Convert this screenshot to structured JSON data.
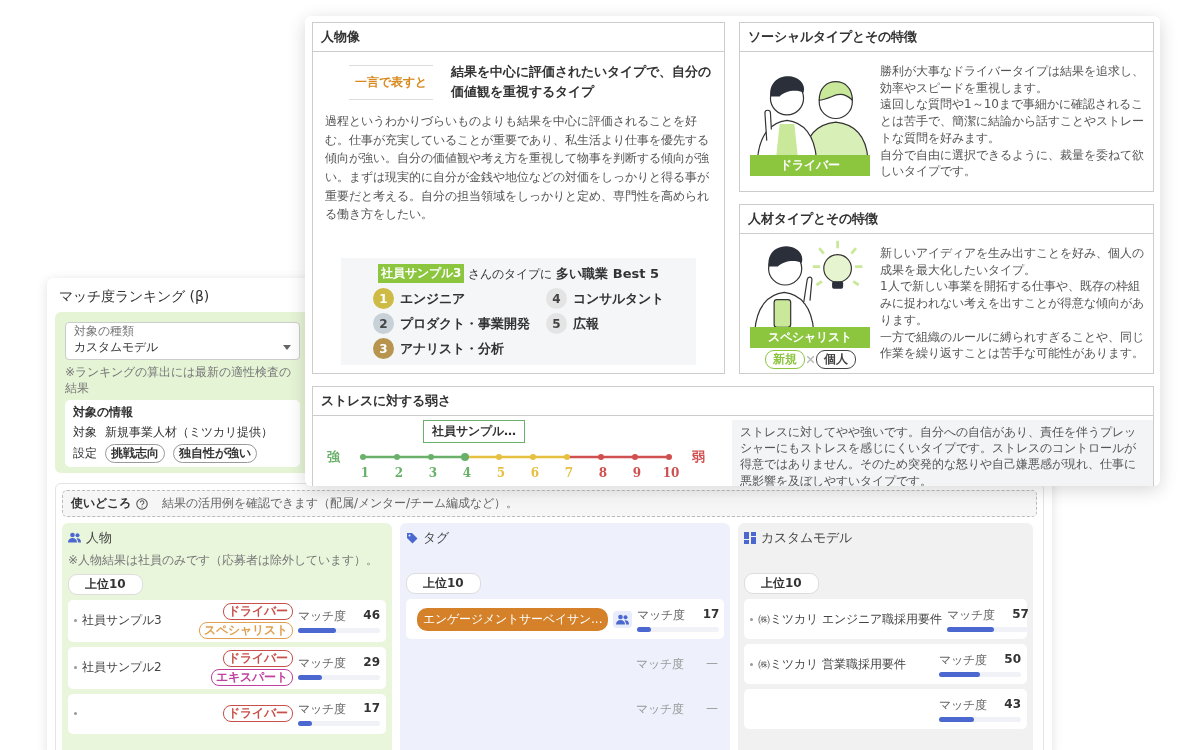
{
  "ranking_window": {
    "title": "マッチ度ランキング (β)",
    "target_type": {
      "label": "対象の種類",
      "value": "カスタムモデル"
    },
    "note": "※ランキングの算出には最新の適性検査の結果",
    "target_info": {
      "heading": "対象の情報",
      "target_label": "対象",
      "target_value": "新規事業人材（ミツカリ提供）",
      "settings_label": "設定",
      "chips": [
        "挑戦志向",
        "独自性が強い"
      ]
    },
    "usage": {
      "title": "使いどころ",
      "description": "結果の活用例を確認できます（配属/メンター/チーム編成など）。"
    },
    "columns": [
      {
        "kind": "people",
        "title": "人物",
        "note": "※人物結果は社員のみです（応募者は除外しています）。",
        "filter": "上位10",
        "rows": [
          {
            "name": "社員サンプル3",
            "tags": [
              {
                "label": "ドライバー",
                "color": "#c9504a"
              },
              {
                "label": "スペシャリスト",
                "color": "#e0a050"
              }
            ],
            "match_label": "マッチ度",
            "score": "46",
            "level": 0.46,
            "disabled": false
          },
          {
            "name": "社員サンプル2",
            "tags": [
              {
                "label": "ドライバー",
                "color": "#c9504a"
              },
              {
                "label": "エキスパート",
                "color": "#c040a0"
              }
            ],
            "match_label": "マッチ度",
            "score": "29",
            "level": 0.29,
            "disabled": false
          },
          {
            "tags": [
              {
                "label": "ドライバー",
                "color": "#c9504a"
              }
            ],
            "match_label": "マッチ度",
            "score": "17",
            "level": 0.17,
            "disabled": false
          }
        ]
      },
      {
        "kind": "tag",
        "title": "タグ",
        "filter": "上位10",
        "rows": [
          {
            "tag": {
              "label": "エンゲージメントサーベイサン...",
              "color": "#d4812a"
            },
            "match_label": "マッチ度",
            "score": "17",
            "level": 0.17,
            "disabled": false
          },
          {
            "match_label": "マッチ度",
            "score": "—",
            "disabled": true
          },
          {
            "match_label": "マッチ度",
            "score": "—",
            "disabled": true
          }
        ]
      },
      {
        "kind": "model",
        "title": "カスタムモデル",
        "filter": "上位10",
        "rows": [
          {
            "name": "㈱ミツカリ エンジニア職採用要件",
            "match_label": "マッチ度",
            "score": "57",
            "level": 0.57,
            "disabled": false
          },
          {
            "name": "㈱ミツカリ 営業職採用要件",
            "match_label": "マッチ度",
            "score": "50",
            "level": 0.5,
            "disabled": false
          },
          {
            "match_label": "マッチ度",
            "score": "43",
            "level": 0.43,
            "disabled": false
          }
        ]
      }
    ]
  },
  "profile_window": {
    "persona": {
      "title": "人物像",
      "summary_label": "一言で表すと",
      "summary": "結果を中心に評価されたいタイプで、自分の価値観を重視するタイプ",
      "description": "過程というわかりづらいものよりも結果を中心に評価されることを好む。仕事が充実していることが重要であり、私生活より仕事を優先する傾向が強い。自分の価値観や考え方を重視して物事を判断する傾向が強い。まずは現実的に自分が金銭や地位などの対価をしっかりと得る事が重要だと考える。自分の担当領域をしっかりと定め、専門性を高められる働き方をしたい。",
      "best_jobs": {
        "name_badge": "社員サンプル3",
        "caption": "さんのタイプに **多い職業 Best 5**",
        "items": [
          {
            "rank": "1",
            "label": "エンジニア",
            "color": "#cdbb45"
          },
          {
            "rank": "2",
            "label": "プロダクト・事業開発",
            "color": "#c8d0d8"
          },
          {
            "rank": "3",
            "label": "アナリスト・分析",
            "color": "#b8954e"
          },
          {
            "rank": "4",
            "label": "コンサルタント",
            "color": "#e4e4e4"
          },
          {
            "rank": "5",
            "label": "広報",
            "color": "#e4e4e4"
          }
        ]
      }
    },
    "social_type": {
      "title": "ソーシャルタイプとその特徴",
      "ribbon": "ドライバー",
      "description": [
        "勝利が大事なドライバータイプは結果を追求し、効率やスピードを重視します。",
        "遠回しな質問や1～10まで事細かに確認されることは苦手で、簡潔に結論から話すことやストレートな質問を好みます。",
        "自分で自由に選択できるように、裁量を委ねて欲しいタイプです。"
      ]
    },
    "talent_type": {
      "title": "人材タイプとその特徴",
      "ribbon": "スペシャリスト",
      "badges": [
        {
          "label": "新規",
          "color": "#8cc63f"
        },
        {
          "label": "個人",
          "color": "#444444"
        }
      ],
      "description": [
        "新しいアイディアを生み出すことを好み、個人の成果を最大化したいタイプ。",
        "1人で新しい事業を開拓する仕事や、既存の枠組みに捉われない考えを出すことが得意な傾向があります。",
        "一方で組織のルールに縛られすぎることや、同じ作業を繰り返すことは苦手な可能性があります。"
      ]
    },
    "stress": {
      "title": "ストレスに対する弱さ",
      "strong_label": "強",
      "weak_label": "弱",
      "marker": "社員サンプル…",
      "points": [
        {
          "label": "1",
          "color": "#6ab06a",
          "selected": false
        },
        {
          "label": "2",
          "color": "#6ab06a",
          "selected": false
        },
        {
          "label": "3",
          "color": "#6ab06a",
          "selected": false
        },
        {
          "label": "4",
          "color": "#6ab06a",
          "selected": true
        },
        {
          "label": "5",
          "color": "#e6c040",
          "selected": false
        },
        {
          "label": "6",
          "color": "#e6c040",
          "selected": false
        },
        {
          "label": "7",
          "color": "#e6c040",
          "selected": false
        },
        {
          "label": "8",
          "color": "#d05050",
          "selected": false
        },
        {
          "label": "9",
          "color": "#d05050",
          "selected": false
        },
        {
          "label": "10",
          "color": "#d05050",
          "selected": false
        }
      ],
      "description": "ストレスに対してやや強いです。自分への自信があり、責任を伴うプレッシャーにもストレスを感じにくいタイプです。ストレスのコントロールが得意ではありません。そのため突発的な怒りや自己嫌悪感が現れ、仕事に悪影響を及ぼしやすいタイプです。"
    }
  }
}
